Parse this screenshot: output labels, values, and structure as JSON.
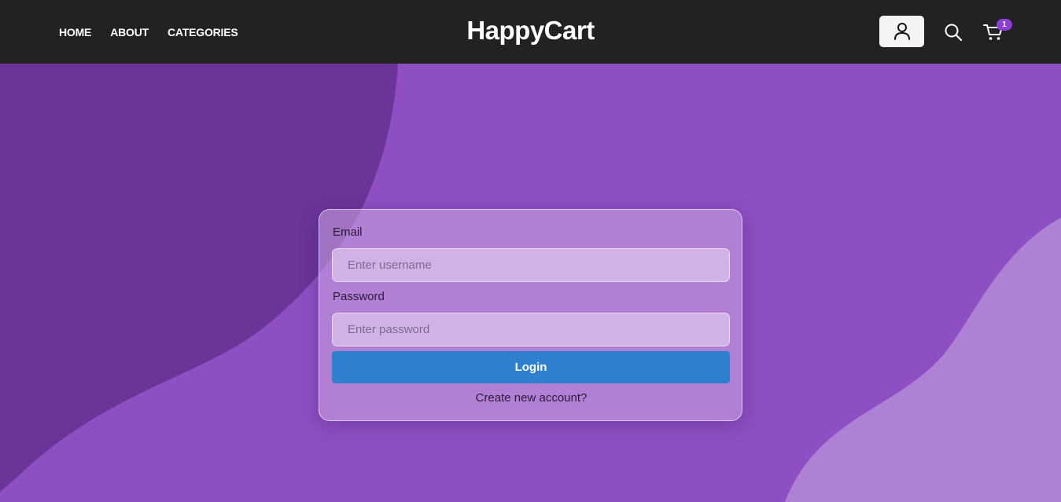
{
  "header": {
    "nav": [
      {
        "label": "HOME"
      },
      {
        "label": "ABOUT"
      },
      {
        "label": "CATEGORIES"
      }
    ],
    "brand": "HappyCart",
    "icons": {
      "user": "user-icon",
      "search": "search-icon",
      "cart": "cart-icon"
    },
    "cart_count": "1"
  },
  "login": {
    "email_label": "Email",
    "email_placeholder": "Enter username",
    "email_value": "",
    "password_label": "Password",
    "password_placeholder": "Enter password",
    "password_value": "",
    "submit_label": "Login",
    "create_account_label": "Create new account?"
  },
  "colors": {
    "header_bg": "#222222",
    "page_bg": "#8e4fc2",
    "dark_wave": "#6b3499",
    "light_wave": "#ad82d5",
    "button": "#2f80d0",
    "badge": "#8b3fd6"
  }
}
